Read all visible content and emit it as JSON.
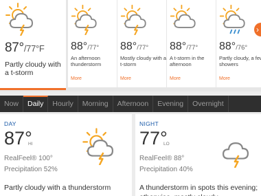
{
  "today": {
    "hi": "87°",
    "lo": "/77°F",
    "desc": "Partly cloudy with a t-storm",
    "icon": "partly-cloudy-tstorm-icon"
  },
  "forecast": [
    {
      "hi": "88°",
      "lo": "/77°",
      "desc": "An afternoon thunderstorm",
      "more": "More",
      "icon": "partly-cloudy-tstorm-icon"
    },
    {
      "hi": "88°",
      "lo": "/77°",
      "desc": "Mostly cloudy with a t-storm",
      "more": "More",
      "icon": "mostly-cloudy-tstorm-icon"
    },
    {
      "hi": "88°",
      "lo": "/77°",
      "desc": "A t-storm in the afternoon",
      "more": "More",
      "icon": "sun-cloud-icon"
    },
    {
      "hi": "88°",
      "lo": "/76°",
      "desc": "Partly cloudy, a few showers",
      "more": "More",
      "icon": "partly-cloudy-showers-icon"
    }
  ],
  "next_arrow": "›",
  "tabs": [
    {
      "label": "Now",
      "active": false
    },
    {
      "label": "Daily",
      "active": true
    },
    {
      "label": "Hourly",
      "active": false
    },
    {
      "label": "Morning",
      "active": false
    },
    {
      "label": "Afternoon",
      "active": false
    },
    {
      "label": "Evening",
      "active": false
    },
    {
      "label": "Overnight",
      "active": false
    }
  ],
  "day": {
    "label": "DAY",
    "temp": "87°",
    "temp_label": "HI",
    "realfeel": "RealFeel® 100°",
    "precip": "Precipitation 52%",
    "desc": "Partly cloudy with a thunderstorm",
    "icon": "partly-cloudy-tstorm-icon"
  },
  "night": {
    "label": "NIGHT",
    "temp": "77°",
    "temp_label": "LO",
    "realfeel": "RealFeel® 88°",
    "precip": "Precipitation 40%",
    "desc": "A thunderstorm in spots this evening; otherwise, mostly cloudy",
    "icon": "cloud-tstorm-icon"
  },
  "colors": {
    "accent": "#f0702a",
    "sun": "#f5a623",
    "cloud_stroke": "#888888",
    "rain": "#3a8fd0",
    "tab_bg": "#2f2f2f",
    "label_blue": "#1a5aa8"
  }
}
